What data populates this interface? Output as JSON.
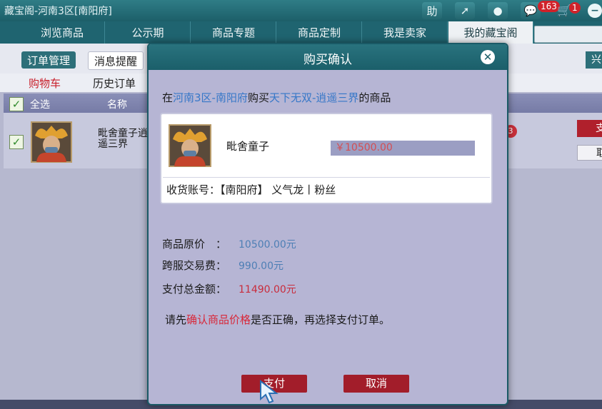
{
  "window": {
    "title": "藏宝阁-河南3区[南阳府]",
    "help_label": "助",
    "message_count": "163",
    "cart_count": "1"
  },
  "nav": {
    "tabs": [
      {
        "label": "浏览商品"
      },
      {
        "label": "公示期"
      },
      {
        "label": "商品专题"
      },
      {
        "label": "商品定制"
      },
      {
        "label": "我是卖家"
      },
      {
        "label": "我的藏宝阁"
      }
    ],
    "active_index": 5
  },
  "background_page": {
    "subtabs": {
      "orders": "订单管理",
      "notify": "消息提醒",
      "export": "兴"
    },
    "tabs2": {
      "cart": "购物车",
      "history": "历史订单"
    },
    "table_header": {
      "select_all": "全选",
      "name": "名称"
    },
    "row": {
      "name": "毗舍童子逍遥三界",
      "badge": "3",
      "pay": "支",
      "cancel": "取"
    }
  },
  "modal": {
    "title": "购买确认",
    "desc_prefix": "在",
    "desc_server": "河南3区-南阳府",
    "desc_mid": "购买",
    "desc_seller": "天下无双-逍遥三界",
    "desc_suffix": "的商品",
    "item_name": "毗舍童子",
    "item_price": "￥10500.00",
    "account_label": "收货账号：",
    "account_value": "【南阳府】 义气龙丨粉丝",
    "summary": [
      {
        "label": "商品原价　：",
        "value": "10500.00元"
      },
      {
        "label": "跨服交易费：",
        "value": "990.00元"
      },
      {
        "label": "支付总金额：",
        "value": "11490.00元"
      }
    ],
    "notice_prefix": "请先",
    "notice_highlight": "确认商品价格",
    "notice_suffix": "是否正确，再选择支付订单。",
    "pay_label": "支付",
    "cancel_label": "取消"
  },
  "colors": {
    "header_teal": "#1f6470",
    "link_blue": "#3677c8",
    "warn_red": "#d8283a",
    "button_red": "#a21d2a"
  }
}
